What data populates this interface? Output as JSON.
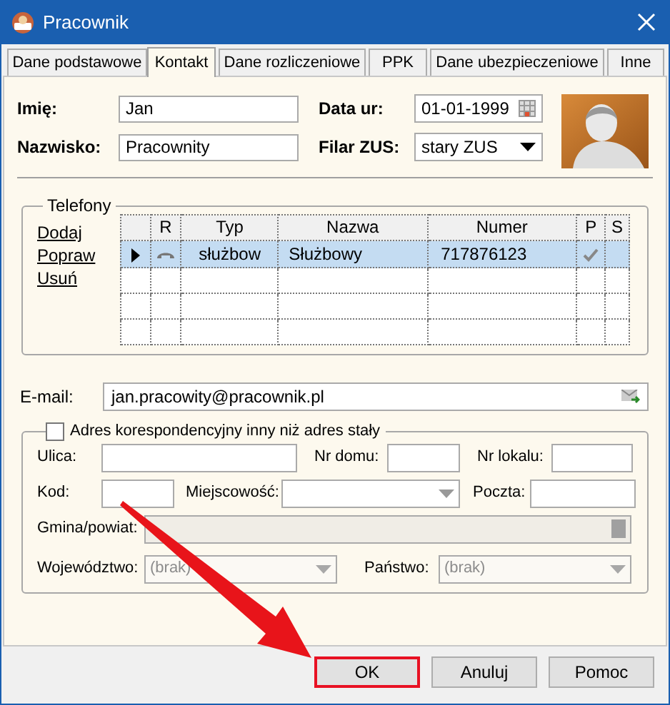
{
  "window": {
    "title": "Pracownik"
  },
  "tabs": [
    {
      "label": "Dane podstawowe",
      "selected": false
    },
    {
      "label": "Kontakt",
      "selected": true
    },
    {
      "label": "Dane rozliczeniowe",
      "selected": false
    },
    {
      "label": "PPK",
      "selected": false
    },
    {
      "label": "Dane ubezpieczeniowe",
      "selected": false
    },
    {
      "label": "Inne",
      "selected": false
    }
  ],
  "person": {
    "first_name": {
      "label": "Imię:",
      "value": "Jan"
    },
    "last_name": {
      "label": "Nazwisko:",
      "value": "Pracownity"
    },
    "birth_date": {
      "label": "Data ur:",
      "value": "01-01-1999"
    },
    "zus": {
      "label": "Filar ZUS:",
      "value": "stary ZUS"
    }
  },
  "phones": {
    "title": "Telefony",
    "actions": [
      "Dodaj",
      "Popraw",
      "Usuń"
    ],
    "columns": [
      "R",
      "Typ",
      "Nazwa",
      "Numer",
      "P",
      "S"
    ],
    "rows": [
      {
        "typ": "służbow",
        "nazwa": "Służbowy",
        "numer": "717876123",
        "p_checked": true,
        "selected": true
      }
    ]
  },
  "email": {
    "label": "E-mail:",
    "value": "jan.pracowity@pracownik.pl"
  },
  "address": {
    "title": "Adres korespondencyjny inny niż adres stały",
    "checked": false,
    "rows": [
      [
        {
          "label": "Ulica:",
          "kind": "text",
          "disabled": false
        },
        {
          "label": "Nr domu:",
          "kind": "text",
          "disabled": false
        },
        {
          "label": "Nr lokalu:",
          "kind": "text",
          "disabled": false
        }
      ],
      [
        {
          "label": "Kod:",
          "kind": "text",
          "disabled": false
        },
        {
          "label": "Miejscowość:",
          "kind": "select",
          "disabled": false
        },
        {
          "label": "Poczta:",
          "kind": "text",
          "disabled": false
        }
      ],
      [
        {
          "label": "Gmina/powiat:",
          "kind": "lookup",
          "disabled": true
        }
      ],
      [
        {
          "label": "Województwo:",
          "kind": "select",
          "disabled": true,
          "value": "(brak)"
        },
        {
          "label": "Państwo:",
          "kind": "select",
          "disabled": true,
          "value": "(brak)"
        }
      ]
    ]
  },
  "buttons": [
    {
      "label": "OK",
      "highlighted": true
    },
    {
      "label": "Anuluj",
      "highlighted": false
    },
    {
      "label": "Pomoc",
      "highlighted": false
    }
  ]
}
